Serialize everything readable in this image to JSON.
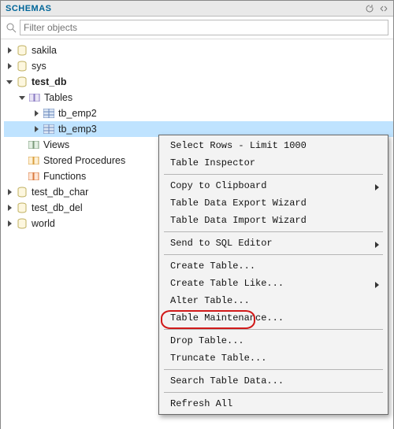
{
  "panel": {
    "title": "SCHEMAS",
    "search_placeholder": "Filter objects"
  },
  "tree": {
    "dbs": [
      {
        "name": "sakila",
        "expanded": false,
        "bold": false
      },
      {
        "name": "sys",
        "expanded": false,
        "bold": false
      },
      {
        "name": "test_db",
        "expanded": true,
        "bold": true,
        "tables_folder": {
          "label": "Tables",
          "expanded": true,
          "tables": [
            {
              "name": "tb_emp2",
              "expanded": false,
              "selected": false
            },
            {
              "name": "tb_emp3",
              "expanded": false,
              "selected": true
            }
          ]
        },
        "views_label": "Views",
        "sp_label": "Stored Procedures",
        "fn_label": "Functions"
      },
      {
        "name": "test_db_char",
        "expanded": false,
        "bold": false
      },
      {
        "name": "test_db_del",
        "expanded": false,
        "bold": false
      },
      {
        "name": "world",
        "expanded": false,
        "bold": false
      }
    ]
  },
  "context_menu": {
    "visible": true,
    "target": "tb_emp3",
    "items": [
      {
        "label": "Select Rows - Limit 1000",
        "submenu": false
      },
      {
        "label": "Table Inspector",
        "submenu": false
      },
      {
        "sep": true
      },
      {
        "label": "Copy to Clipboard",
        "submenu": true
      },
      {
        "label": "Table Data Export Wizard",
        "submenu": false
      },
      {
        "label": "Table Data Import Wizard",
        "submenu": false
      },
      {
        "sep": true
      },
      {
        "label": "Send to SQL Editor",
        "submenu": true
      },
      {
        "sep": true
      },
      {
        "label": "Create Table...",
        "submenu": false
      },
      {
        "label": "Create Table Like...",
        "submenu": true
      },
      {
        "label": "Alter Table...",
        "submenu": false
      },
      {
        "label": "Table Maintenance...",
        "submenu": false
      },
      {
        "sep": true
      },
      {
        "label": "Drop Table...",
        "submenu": false,
        "highlighted": true
      },
      {
        "label": "Truncate Table...",
        "submenu": false
      },
      {
        "sep": true
      },
      {
        "label": "Search Table Data...",
        "submenu": false
      },
      {
        "sep": true
      },
      {
        "label": "Refresh All",
        "submenu": false
      }
    ]
  }
}
